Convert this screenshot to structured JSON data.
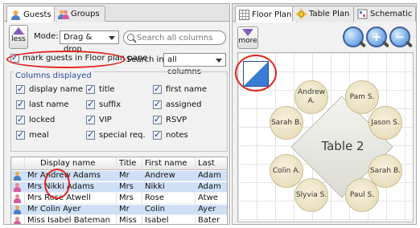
{
  "left_tabs": [
    {
      "label": "Guests",
      "active": true,
      "icon": "guests-icon"
    },
    {
      "label": "Groups",
      "active": false,
      "icon": "groups-icon"
    }
  ],
  "toolbar": {
    "less_label": "less",
    "mode_label": "Mode:",
    "mode_value": "Drag & drop",
    "search_placeholder": "Search all columns"
  },
  "mark_guests_label": "mark guests in Floor plan pane",
  "mark_guests_checked": true,
  "search_in": {
    "label": "Search in:",
    "value": "all columns"
  },
  "columns_displayed": {
    "title": "Columns displayed",
    "items": [
      {
        "label": "display name",
        "checked": true
      },
      {
        "label": "title",
        "checked": true
      },
      {
        "label": "first name",
        "checked": true
      },
      {
        "label": "last name",
        "checked": true
      },
      {
        "label": "suffix",
        "checked": true
      },
      {
        "label": "assigned",
        "checked": true
      },
      {
        "label": "locked",
        "checked": true
      },
      {
        "label": "VIP",
        "checked": true
      },
      {
        "label": "RSVP",
        "checked": true
      },
      {
        "label": "meal",
        "checked": true
      },
      {
        "label": "special req.",
        "checked": true
      },
      {
        "label": "notes",
        "checked": true
      }
    ]
  },
  "guest_table": {
    "headers": [
      "Display name",
      "Title",
      "First name",
      "Last"
    ],
    "rows": [
      {
        "display": "Mr Andrew Adams",
        "title": "Mr",
        "first": "Andrew",
        "last": "Adam"
      },
      {
        "display": "Mrs Nikki Adams",
        "title": "Mrs",
        "first": "Nikki",
        "last": "Adam"
      },
      {
        "display": "Mrs Rose Atwell",
        "title": "Mrs",
        "first": "Rose",
        "last": "Atwe"
      },
      {
        "display": "Mr Colin Ayer",
        "title": "Mr",
        "first": "Colin",
        "last": "Ayer"
      },
      {
        "display": "Miss Isabel Bateman",
        "title": "Miss",
        "first": "Isabel",
        "last": "Bater"
      }
    ]
  },
  "right_tabs": [
    {
      "label": "Floor Plan",
      "active": true,
      "icon": "floor-plan-icon"
    },
    {
      "label": "Table Plan",
      "active": false,
      "icon": "table-plan-icon"
    },
    {
      "label": "Schematic",
      "active": false,
      "icon": "schematic-icon"
    }
  ],
  "more_label": "more",
  "zoom_buttons": [
    {
      "icon": "zoom-fit-icon",
      "symbol": ""
    },
    {
      "icon": "zoom-in-icon",
      "symbol": "+"
    },
    {
      "icon": "zoom-out-icon",
      "symbol": "−"
    }
  ],
  "floor_plan": {
    "table_name": "Table 2",
    "seats": [
      "Andrew A.",
      "Pam S.",
      "Sarah B.",
      "Jason S.",
      "Colin A.",
      "Sarah B.",
      "Slyvia S.",
      "Paul S."
    ]
  },
  "colors": {
    "accent": "#e2231a",
    "selection": "#cfe0f6",
    "marker": "#3a7bd5"
  }
}
